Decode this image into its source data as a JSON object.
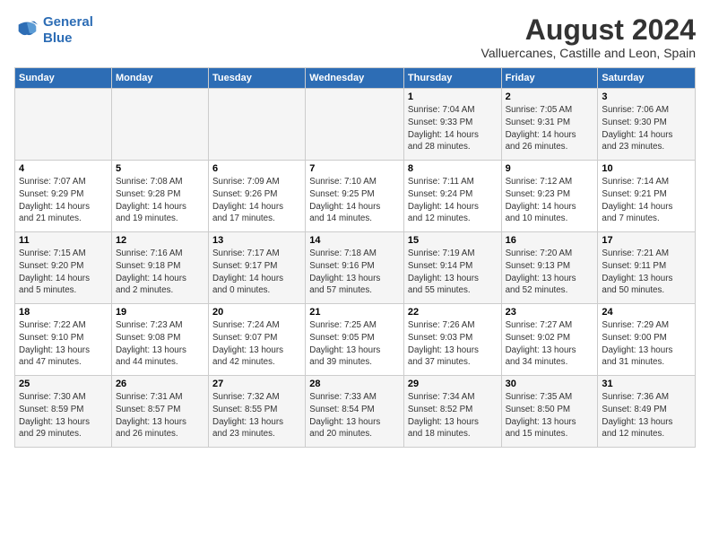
{
  "logo": {
    "line1": "General",
    "line2": "Blue"
  },
  "title": "August 2024",
  "subtitle": "Valluercanes, Castille and Leon, Spain",
  "headers": [
    "Sunday",
    "Monday",
    "Tuesday",
    "Wednesday",
    "Thursday",
    "Friday",
    "Saturday"
  ],
  "weeks": [
    [
      {
        "day": "",
        "info": ""
      },
      {
        "day": "",
        "info": ""
      },
      {
        "day": "",
        "info": ""
      },
      {
        "day": "",
        "info": ""
      },
      {
        "day": "1",
        "info": "Sunrise: 7:04 AM\nSunset: 9:33 PM\nDaylight: 14 hours\nand 28 minutes."
      },
      {
        "day": "2",
        "info": "Sunrise: 7:05 AM\nSunset: 9:31 PM\nDaylight: 14 hours\nand 26 minutes."
      },
      {
        "day": "3",
        "info": "Sunrise: 7:06 AM\nSunset: 9:30 PM\nDaylight: 14 hours\nand 23 minutes."
      }
    ],
    [
      {
        "day": "4",
        "info": "Sunrise: 7:07 AM\nSunset: 9:29 PM\nDaylight: 14 hours\nand 21 minutes."
      },
      {
        "day": "5",
        "info": "Sunrise: 7:08 AM\nSunset: 9:28 PM\nDaylight: 14 hours\nand 19 minutes."
      },
      {
        "day": "6",
        "info": "Sunrise: 7:09 AM\nSunset: 9:26 PM\nDaylight: 14 hours\nand 17 minutes."
      },
      {
        "day": "7",
        "info": "Sunrise: 7:10 AM\nSunset: 9:25 PM\nDaylight: 14 hours\nand 14 minutes."
      },
      {
        "day": "8",
        "info": "Sunrise: 7:11 AM\nSunset: 9:24 PM\nDaylight: 14 hours\nand 12 minutes."
      },
      {
        "day": "9",
        "info": "Sunrise: 7:12 AM\nSunset: 9:23 PM\nDaylight: 14 hours\nand 10 minutes."
      },
      {
        "day": "10",
        "info": "Sunrise: 7:14 AM\nSunset: 9:21 PM\nDaylight: 14 hours\nand 7 minutes."
      }
    ],
    [
      {
        "day": "11",
        "info": "Sunrise: 7:15 AM\nSunset: 9:20 PM\nDaylight: 14 hours\nand 5 minutes."
      },
      {
        "day": "12",
        "info": "Sunrise: 7:16 AM\nSunset: 9:18 PM\nDaylight: 14 hours\nand 2 minutes."
      },
      {
        "day": "13",
        "info": "Sunrise: 7:17 AM\nSunset: 9:17 PM\nDaylight: 14 hours\nand 0 minutes."
      },
      {
        "day": "14",
        "info": "Sunrise: 7:18 AM\nSunset: 9:16 PM\nDaylight: 13 hours\nand 57 minutes."
      },
      {
        "day": "15",
        "info": "Sunrise: 7:19 AM\nSunset: 9:14 PM\nDaylight: 13 hours\nand 55 minutes."
      },
      {
        "day": "16",
        "info": "Sunrise: 7:20 AM\nSunset: 9:13 PM\nDaylight: 13 hours\nand 52 minutes."
      },
      {
        "day": "17",
        "info": "Sunrise: 7:21 AM\nSunset: 9:11 PM\nDaylight: 13 hours\nand 50 minutes."
      }
    ],
    [
      {
        "day": "18",
        "info": "Sunrise: 7:22 AM\nSunset: 9:10 PM\nDaylight: 13 hours\nand 47 minutes."
      },
      {
        "day": "19",
        "info": "Sunrise: 7:23 AM\nSunset: 9:08 PM\nDaylight: 13 hours\nand 44 minutes."
      },
      {
        "day": "20",
        "info": "Sunrise: 7:24 AM\nSunset: 9:07 PM\nDaylight: 13 hours\nand 42 minutes."
      },
      {
        "day": "21",
        "info": "Sunrise: 7:25 AM\nSunset: 9:05 PM\nDaylight: 13 hours\nand 39 minutes."
      },
      {
        "day": "22",
        "info": "Sunrise: 7:26 AM\nSunset: 9:03 PM\nDaylight: 13 hours\nand 37 minutes."
      },
      {
        "day": "23",
        "info": "Sunrise: 7:27 AM\nSunset: 9:02 PM\nDaylight: 13 hours\nand 34 minutes."
      },
      {
        "day": "24",
        "info": "Sunrise: 7:29 AM\nSunset: 9:00 PM\nDaylight: 13 hours\nand 31 minutes."
      }
    ],
    [
      {
        "day": "25",
        "info": "Sunrise: 7:30 AM\nSunset: 8:59 PM\nDaylight: 13 hours\nand 29 minutes."
      },
      {
        "day": "26",
        "info": "Sunrise: 7:31 AM\nSunset: 8:57 PM\nDaylight: 13 hours\nand 26 minutes."
      },
      {
        "day": "27",
        "info": "Sunrise: 7:32 AM\nSunset: 8:55 PM\nDaylight: 13 hours\nand 23 minutes."
      },
      {
        "day": "28",
        "info": "Sunrise: 7:33 AM\nSunset: 8:54 PM\nDaylight: 13 hours\nand 20 minutes."
      },
      {
        "day": "29",
        "info": "Sunrise: 7:34 AM\nSunset: 8:52 PM\nDaylight: 13 hours\nand 18 minutes."
      },
      {
        "day": "30",
        "info": "Sunrise: 7:35 AM\nSunset: 8:50 PM\nDaylight: 13 hours\nand 15 minutes."
      },
      {
        "day": "31",
        "info": "Sunrise: 7:36 AM\nSunset: 8:49 PM\nDaylight: 13 hours\nand 12 minutes."
      }
    ]
  ]
}
